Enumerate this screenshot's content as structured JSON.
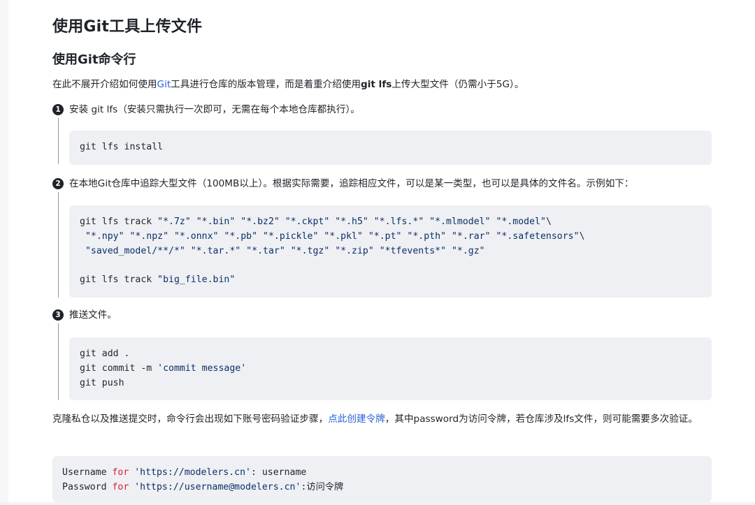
{
  "title": "使用Git工具上传文件",
  "subtitle": "使用Git命令行",
  "intro": {
    "prefix": "在此不展开介绍如何使用",
    "link": "Git",
    "middle": "工具进行仓库的版本管理，而是着重介绍使用",
    "bold": "git lfs",
    "suffix": "上传大型文件（仍需小于5G）。"
  },
  "steps": [
    {
      "num": "1",
      "text": "安装 git lfs（安装只需执行一次即可，无需在每个本地仓库都执行）。"
    },
    {
      "num": "2",
      "text": "在本地Git仓库中追踪大型文件（100MB以上）。根据实际需要，追踪相应文件，可以是某一类型，也可以是具体的文件名。示例如下："
    },
    {
      "num": "3",
      "text": "推送文件。"
    }
  ],
  "code": {
    "install": "git lfs install",
    "track_line1_cmd": "git lfs track ",
    "track_line1_args": "\"*.7z\" \"*.bin\" \"*.bz2\" \"*.ckpt\" \"*.h5\" \"*.lfs.*\" \"*.mlmodel\" \"*.model\"",
    "track_line1_end": "\\",
    "track_line2_args": " \"*.npy\" \"*.npz\" \"*.onnx\" \"*.pb\" \"*.pickle\" \"*.pkl\" \"*.pt\" \"*.pth\" \"*.rar\" \"*.safetensors\"",
    "track_line2_end": "\\",
    "track_line3_args": " \"saved_model/**/*\" \"*.tar.*\" \"*.tar\" \"*.tgz\" \"*.zip\" \"*tfevents*\" \"*.gz\"",
    "track_line4_cmd": "git lfs track ",
    "track_line4_arg": "\"big_file.bin\"",
    "push_line1": "git add .",
    "push_line2_cmd": "git commit -m ",
    "push_line2_arg": "'commit message'",
    "push_line3": "git push",
    "auth_line1_a": "Username ",
    "auth_line1_kw": "for",
    "auth_line1_str": " 'https://modelers.cn'",
    "auth_line1_b": ": username",
    "auth_line2_a": "Password ",
    "auth_line2_kw": "for",
    "auth_line2_str": " 'https://username@modelers.cn'",
    "auth_line2_b": ":访问令牌"
  },
  "outro": {
    "prefix": "克隆私仓以及推送提交时，命令行会出现如下账号密码验证步骤，",
    "link": "点此创建令牌",
    "suffix": "，其中password为访问令牌，若仓库涉及lfs文件，则可能需要多次验证。"
  }
}
